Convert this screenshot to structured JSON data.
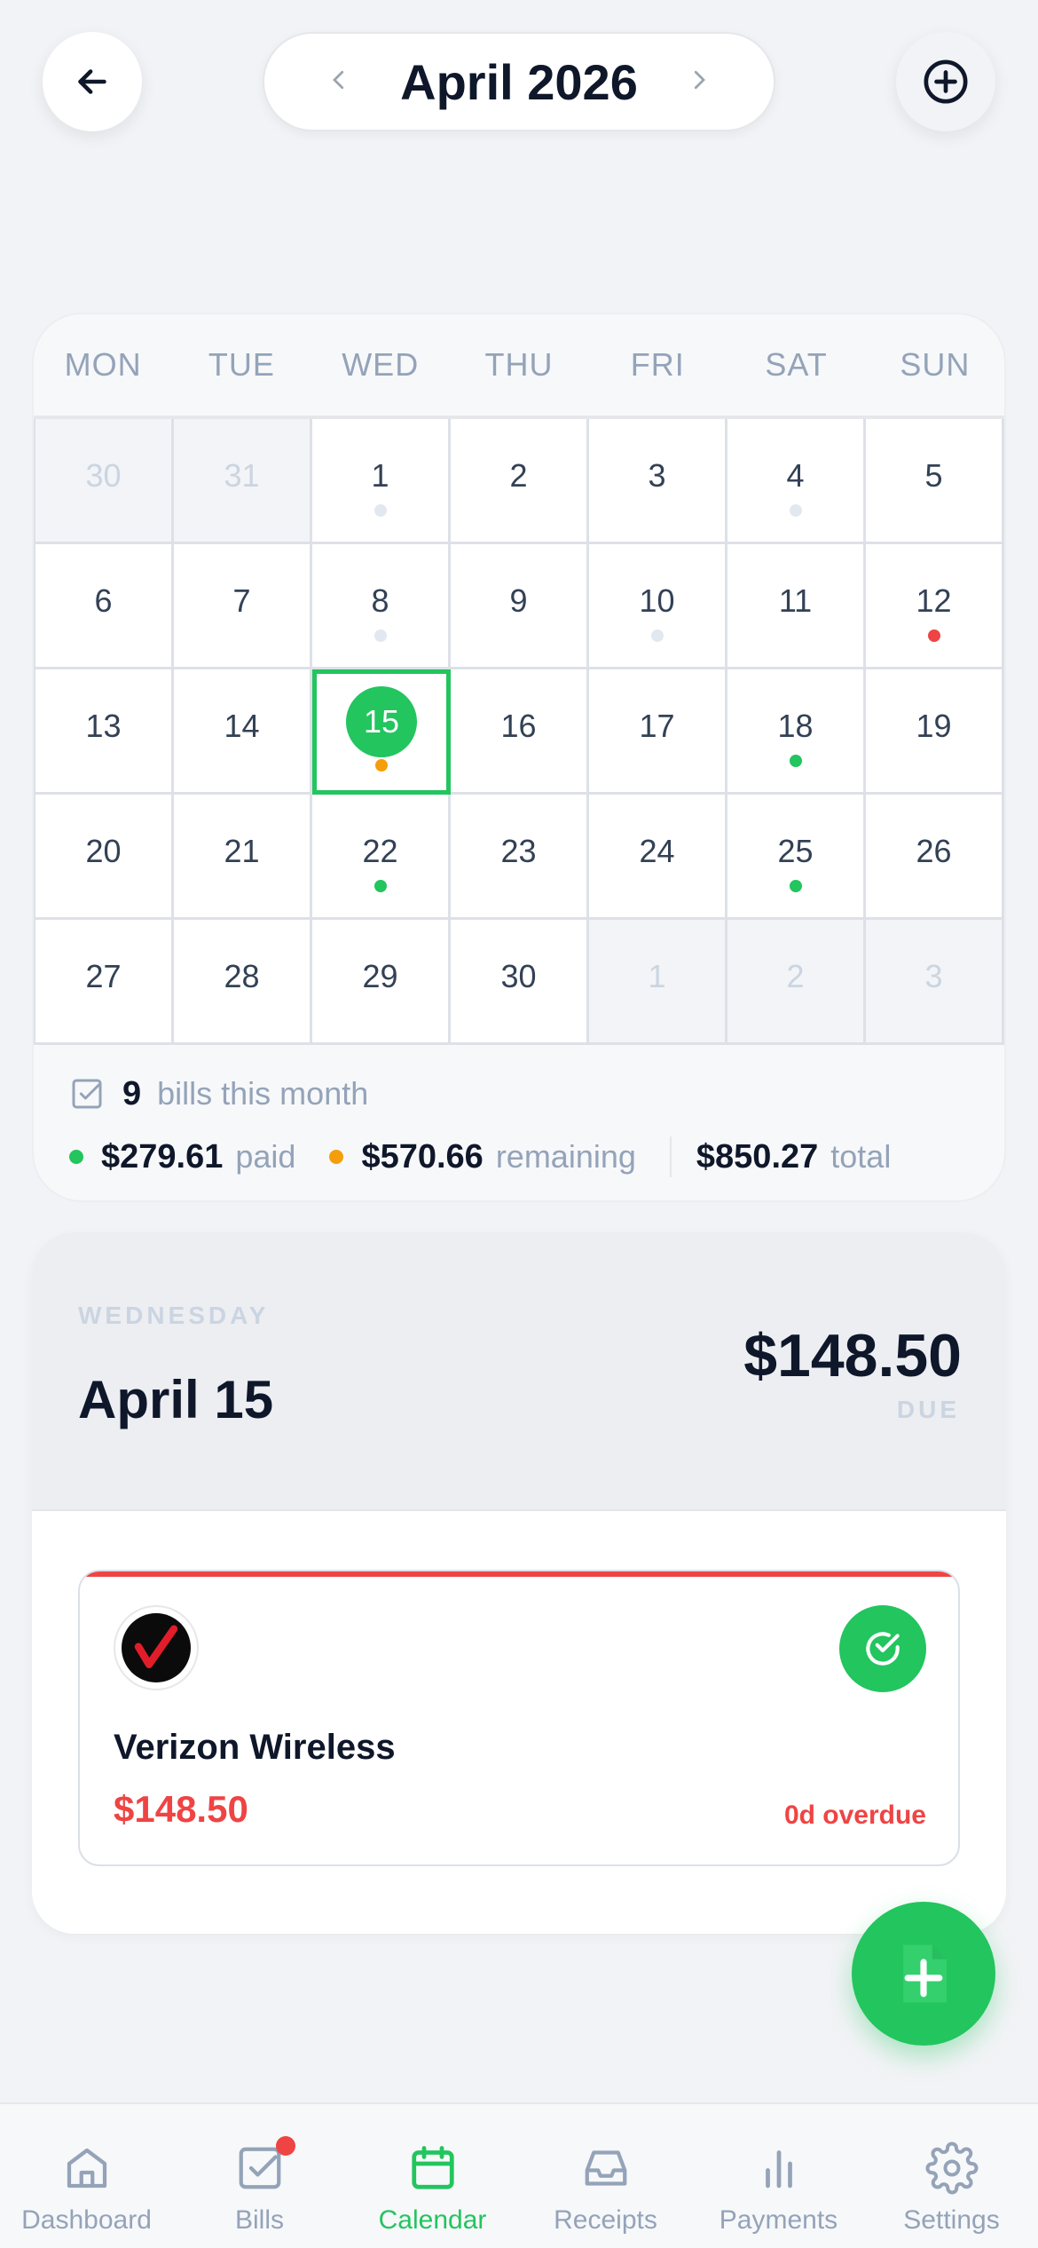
{
  "header": {
    "month_title": "April 2026",
    "prev_icon": "chevron-left-icon",
    "next_icon": "chevron-right-icon",
    "back_icon": "arrow-left-icon",
    "add_icon": "plus-circle-icon"
  },
  "calendar": {
    "weekdays": [
      "MON",
      "TUE",
      "WED",
      "THU",
      "FRI",
      "SAT",
      "SUN"
    ],
    "days": [
      {
        "label": "30",
        "muted": true,
        "dot": null
      },
      {
        "label": "31",
        "muted": true,
        "dot": null
      },
      {
        "label": "1",
        "muted": false,
        "dot": "gray"
      },
      {
        "label": "2",
        "muted": false,
        "dot": null
      },
      {
        "label": "3",
        "muted": false,
        "dot": null
      },
      {
        "label": "4",
        "muted": false,
        "dot": "gray"
      },
      {
        "label": "5",
        "muted": false,
        "dot": null
      },
      {
        "label": "6",
        "muted": false,
        "dot": null
      },
      {
        "label": "7",
        "muted": false,
        "dot": null
      },
      {
        "label": "8",
        "muted": false,
        "dot": "gray"
      },
      {
        "label": "9",
        "muted": false,
        "dot": null
      },
      {
        "label": "10",
        "muted": false,
        "dot": "gray"
      },
      {
        "label": "11",
        "muted": false,
        "dot": null
      },
      {
        "label": "12",
        "muted": false,
        "dot": "red"
      },
      {
        "label": "13",
        "muted": false,
        "dot": null
      },
      {
        "label": "14",
        "muted": false,
        "dot": null
      },
      {
        "label": "15",
        "muted": false,
        "dot": "orange",
        "selected": true
      },
      {
        "label": "16",
        "muted": false,
        "dot": null
      },
      {
        "label": "17",
        "muted": false,
        "dot": null
      },
      {
        "label": "18",
        "muted": false,
        "dot": "green"
      },
      {
        "label": "19",
        "muted": false,
        "dot": null
      },
      {
        "label": "20",
        "muted": false,
        "dot": null
      },
      {
        "label": "21",
        "muted": false,
        "dot": null
      },
      {
        "label": "22",
        "muted": false,
        "dot": "green"
      },
      {
        "label": "23",
        "muted": false,
        "dot": null
      },
      {
        "label": "24",
        "muted": false,
        "dot": null
      },
      {
        "label": "25",
        "muted": false,
        "dot": "green"
      },
      {
        "label": "26",
        "muted": false,
        "dot": null
      },
      {
        "label": "27",
        "muted": false,
        "dot": null
      },
      {
        "label": "28",
        "muted": false,
        "dot": null
      },
      {
        "label": "29",
        "muted": false,
        "dot": null
      },
      {
        "label": "30",
        "muted": false,
        "dot": null
      },
      {
        "label": "1",
        "muted": true,
        "dot": null
      },
      {
        "label": "2",
        "muted": true,
        "dot": null
      },
      {
        "label": "3",
        "muted": true,
        "dot": null
      }
    ],
    "dot_colors": {
      "gray": "#e2e8f0",
      "red": "#ef4444",
      "orange": "#f59e0b",
      "green": "#22c55e"
    }
  },
  "summary": {
    "bill_count": "9",
    "bill_count_label": "bills this month",
    "paid_amount": "$279.61",
    "paid_label": "paid",
    "remaining_amount": "$570.66",
    "remaining_label": "remaining",
    "total_amount": "$850.27",
    "total_label": "total"
  },
  "day": {
    "weekday": "WEDNESDAY",
    "date": "April 15",
    "due_amount": "$148.50",
    "due_label": "DUE"
  },
  "bill": {
    "name": "Verizon Wireless",
    "amount": "$148.50",
    "status": "0d overdue",
    "logo_icon": "verizon-logo-icon",
    "action_icon": "check-circle-icon"
  },
  "fab": {
    "icon": "add-document-icon"
  },
  "tabs": [
    {
      "label": "Dashboard",
      "icon": "home-icon",
      "active": false
    },
    {
      "label": "Bills",
      "icon": "checkbox-icon",
      "active": false,
      "badge": true
    },
    {
      "label": "Calendar",
      "icon": "calendar-icon",
      "active": true
    },
    {
      "label": "Receipts",
      "icon": "inbox-icon",
      "active": false
    },
    {
      "label": "Payments",
      "icon": "bar-chart-icon",
      "active": false
    },
    {
      "label": "Settings",
      "icon": "gear-icon",
      "active": false
    }
  ],
  "colors": {
    "accent": "#22c55e",
    "danger": "#ef4444",
    "warning": "#f59e0b"
  }
}
